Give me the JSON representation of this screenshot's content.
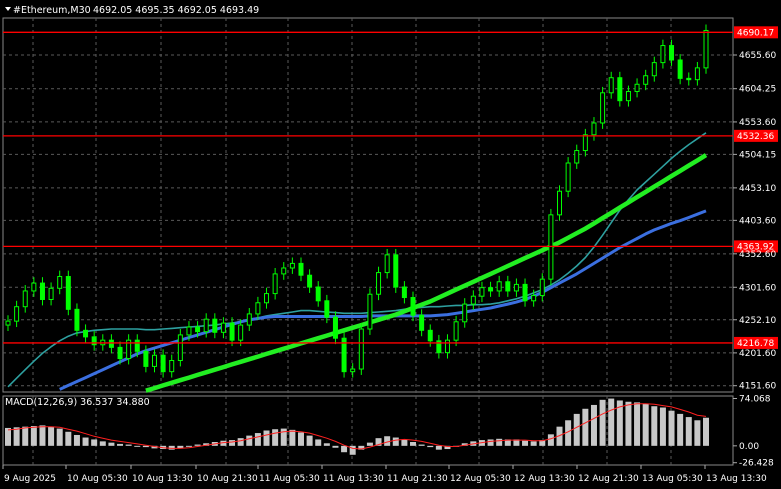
{
  "header": {
    "symbol": "#Ethereum,M30",
    "ohlc": "4692.05 4695.35 4692.05 4693.49"
  },
  "indicator": {
    "label": "MACD(12,26,9) 36.537 34.880"
  },
  "colors": {
    "background": "#000000",
    "grid": "#5a5a5a",
    "bull": "#00ff00",
    "level": "#ff0000",
    "level_label_bg": "#ff0000",
    "ma_fast": "#2ea0a0",
    "ma_mid": "#3b6fe0",
    "ma_slow": "#22ee22",
    "macd_hist": "#c8c8c8",
    "macd_signal": "#ff2020"
  },
  "chart_data": [
    {
      "type": "line",
      "name": "price",
      "x_labels": [
        "9 Aug 2025",
        "10 Aug 05:30",
        "10 Aug 13:30",
        "10 Aug 21:30",
        "11 Aug 05:30",
        "11 Aug 13:30",
        "11 Aug 21:30",
        "12 Aug 05:30",
        "12 Aug 13:30",
        "12 Aug 21:30",
        "13 Aug 05:30",
        "13 Aug 13:30"
      ],
      "y_ticks": [
        "4655.60",
        "4604.25",
        "4553.60",
        "4504.15",
        "4453.10",
        "4403.60",
        "4352.60",
        "4301.60",
        "4252.10",
        "4201.60",
        "4151.60"
      ],
      "ylim": [
        4142,
        4712
      ],
      "levels": [
        {
          "value": 4690.17,
          "label": "4690.17"
        },
        {
          "value": 4532.36,
          "label": "4532.36"
        },
        {
          "value": 4363.92,
          "label": "4363.92"
        },
        {
          "value": 4216.78,
          "label": "4216.78"
        }
      ],
      "close": [
        4250,
        4272,
        4296,
        4308,
        4283,
        4300,
        4318,
        4268,
        4236,
        4226,
        4214,
        4221,
        4210,
        4193,
        4221,
        4204,
        4181,
        4198,
        4173,
        4190,
        4229,
        4241,
        4234,
        4253,
        4233,
        4247,
        4221,
        4244,
        4261,
        4278,
        4292,
        4322,
        4331,
        4338,
        4320,
        4302,
        4281,
        4256,
        4224,
        4173,
        4177,
        4238,
        4291,
        4324,
        4351,
        4302,
        4286,
        4259,
        4236,
        4220,
        4202,
        4221,
        4249,
        4276,
        4288,
        4301,
        4296,
        4310,
        4296,
        4306,
        4281,
        4289,
        4314,
        4412,
        4448,
        4491,
        4510,
        4534,
        4552,
        4598,
        4621,
        4586,
        4600,
        4611,
        4624,
        4644,
        4670,
        4648,
        4620,
        4618,
        4636,
        4693
      ],
      "ma_fast": [
        4150,
        4163,
        4176,
        4189,
        4201,
        4211,
        4220,
        4227,
        4232,
        4234,
        4236,
        4237,
        4238,
        4238,
        4238,
        4238,
        4237,
        4237,
        4238,
        4239,
        4240,
        4241,
        4242,
        4243,
        4244,
        4246,
        4247,
        4249,
        4252,
        4255,
        4258,
        4260,
        4262,
        4264,
        4266,
        4266,
        4265,
        4264,
        4263,
        4262,
        4262,
        4262,
        4263,
        4264,
        4265,
        4266,
        4268,
        4270,
        4271,
        4272,
        4272,
        4273,
        4274,
        4274,
        4275,
        4275,
        4276,
        4278,
        4281,
        4284,
        4288,
        4293,
        4298,
        4305,
        4313,
        4323,
        4334,
        4347,
        4363,
        4381,
        4400,
        4419,
        4435,
        4450,
        4462,
        4474,
        4486,
        4498,
        4509,
        4519,
        4528,
        4537
      ],
      "ma_mid": [
        4110,
        4116,
        4122,
        4128,
        4134,
        4140,
        4146,
        4152,
        4158,
        4164,
        4170,
        4176,
        4182,
        4188,
        4194,
        4200,
        4205,
        4209,
        4213,
        4217,
        4221,
        4225,
        4229,
        4233,
        4237,
        4241,
        4245,
        4249,
        4252,
        4254,
        4256,
        4257,
        4257,
        4257,
        4257,
        4257,
        4257,
        4257,
        4257,
        4257,
        4257,
        4257,
        4258,
        4258,
        4258,
        4258,
        4258,
        4258,
        4258,
        4258,
        4259,
        4260,
        4262,
        4264,
        4266,
        4268,
        4270,
        4273,
        4276,
        4279,
        4283,
        4288,
        4294,
        4301,
        4308,
        4315,
        4322,
        4330,
        4338,
        4346,
        4354,
        4362,
        4369,
        4376,
        4383,
        4389,
        4394,
        4399,
        4403,
        4408,
        4413,
        4418
      ],
      "ma_slow": [
        4080,
        4084,
        4088,
        4092,
        4096,
        4100,
        4104,
        4108,
        4112,
        4116,
        4120,
        4124,
        4128,
        4132,
        4136,
        4140,
        4144,
        4148,
        4152,
        4156,
        4160,
        4164,
        4168,
        4172,
        4176,
        4180,
        4184,
        4188,
        4192,
        4196,
        4200,
        4204,
        4208,
        4212,
        4216,
        4220,
        4224,
        4228,
        4232,
        4236,
        4240,
        4244,
        4248,
        4252,
        4256,
        4260,
        4265,
        4270,
        4275,
        4280,
        4286,
        4292,
        4298,
        4304,
        4310,
        4316,
        4322,
        4328,
        4334,
        4340,
        4346,
        4352,
        4358,
        4364,
        4370,
        4377,
        4384,
        4391,
        4399,
        4407,
        4415,
        4423,
        4431,
        4439,
        4447,
        4455,
        4463,
        4471,
        4479,
        4487,
        4495,
        4503
      ]
    },
    {
      "type": "bar",
      "name": "MACD(12,26,9)",
      "y_ticks": [
        "74.068",
        "0.00",
        "-26.428"
      ],
      "ylim": [
        -30,
        78
      ],
      "histogram": [
        28,
        29,
        30,
        31,
        32,
        30,
        27,
        22,
        17,
        13,
        10,
        7,
        5,
        3,
        2,
        0,
        -2,
        -4,
        -5,
        -6,
        -4,
        -1,
        2,
        4,
        6,
        8,
        9,
        12,
        16,
        20,
        24,
        26,
        27,
        25,
        21,
        16,
        10,
        4,
        -3,
        -10,
        -14,
        -6,
        5,
        12,
        15,
        13,
        10,
        6,
        2,
        -2,
        -6,
        -5,
        0,
        4,
        7,
        9,
        10,
        11,
        10,
        10,
        8,
        7,
        9,
        18,
        30,
        40,
        50,
        58,
        64,
        72,
        74,
        71,
        69,
        68,
        66,
        62,
        60,
        55,
        50,
        45,
        40,
        44
      ],
      "signal": [
        25,
        26,
        28,
        29,
        30,
        30,
        29,
        26,
        23,
        19,
        15,
        12,
        9,
        7,
        5,
        3,
        1,
        -1,
        -3,
        -4,
        -4,
        -3,
        -1,
        1,
        3,
        5,
        6,
        8,
        11,
        14,
        17,
        20,
        22,
        23,
        22,
        20,
        16,
        12,
        7,
        1,
        -4,
        -5,
        -2,
        2,
        6,
        9,
        10,
        9,
        7,
        4,
        1,
        -1,
        -1,
        1,
        3,
        5,
        7,
        8,
        9,
        9,
        9,
        8,
        8,
        11,
        16,
        22,
        29,
        36,
        43,
        50,
        56,
        61,
        64,
        66,
        66,
        65,
        63,
        61,
        57,
        53,
        48,
        46
      ]
    }
  ]
}
